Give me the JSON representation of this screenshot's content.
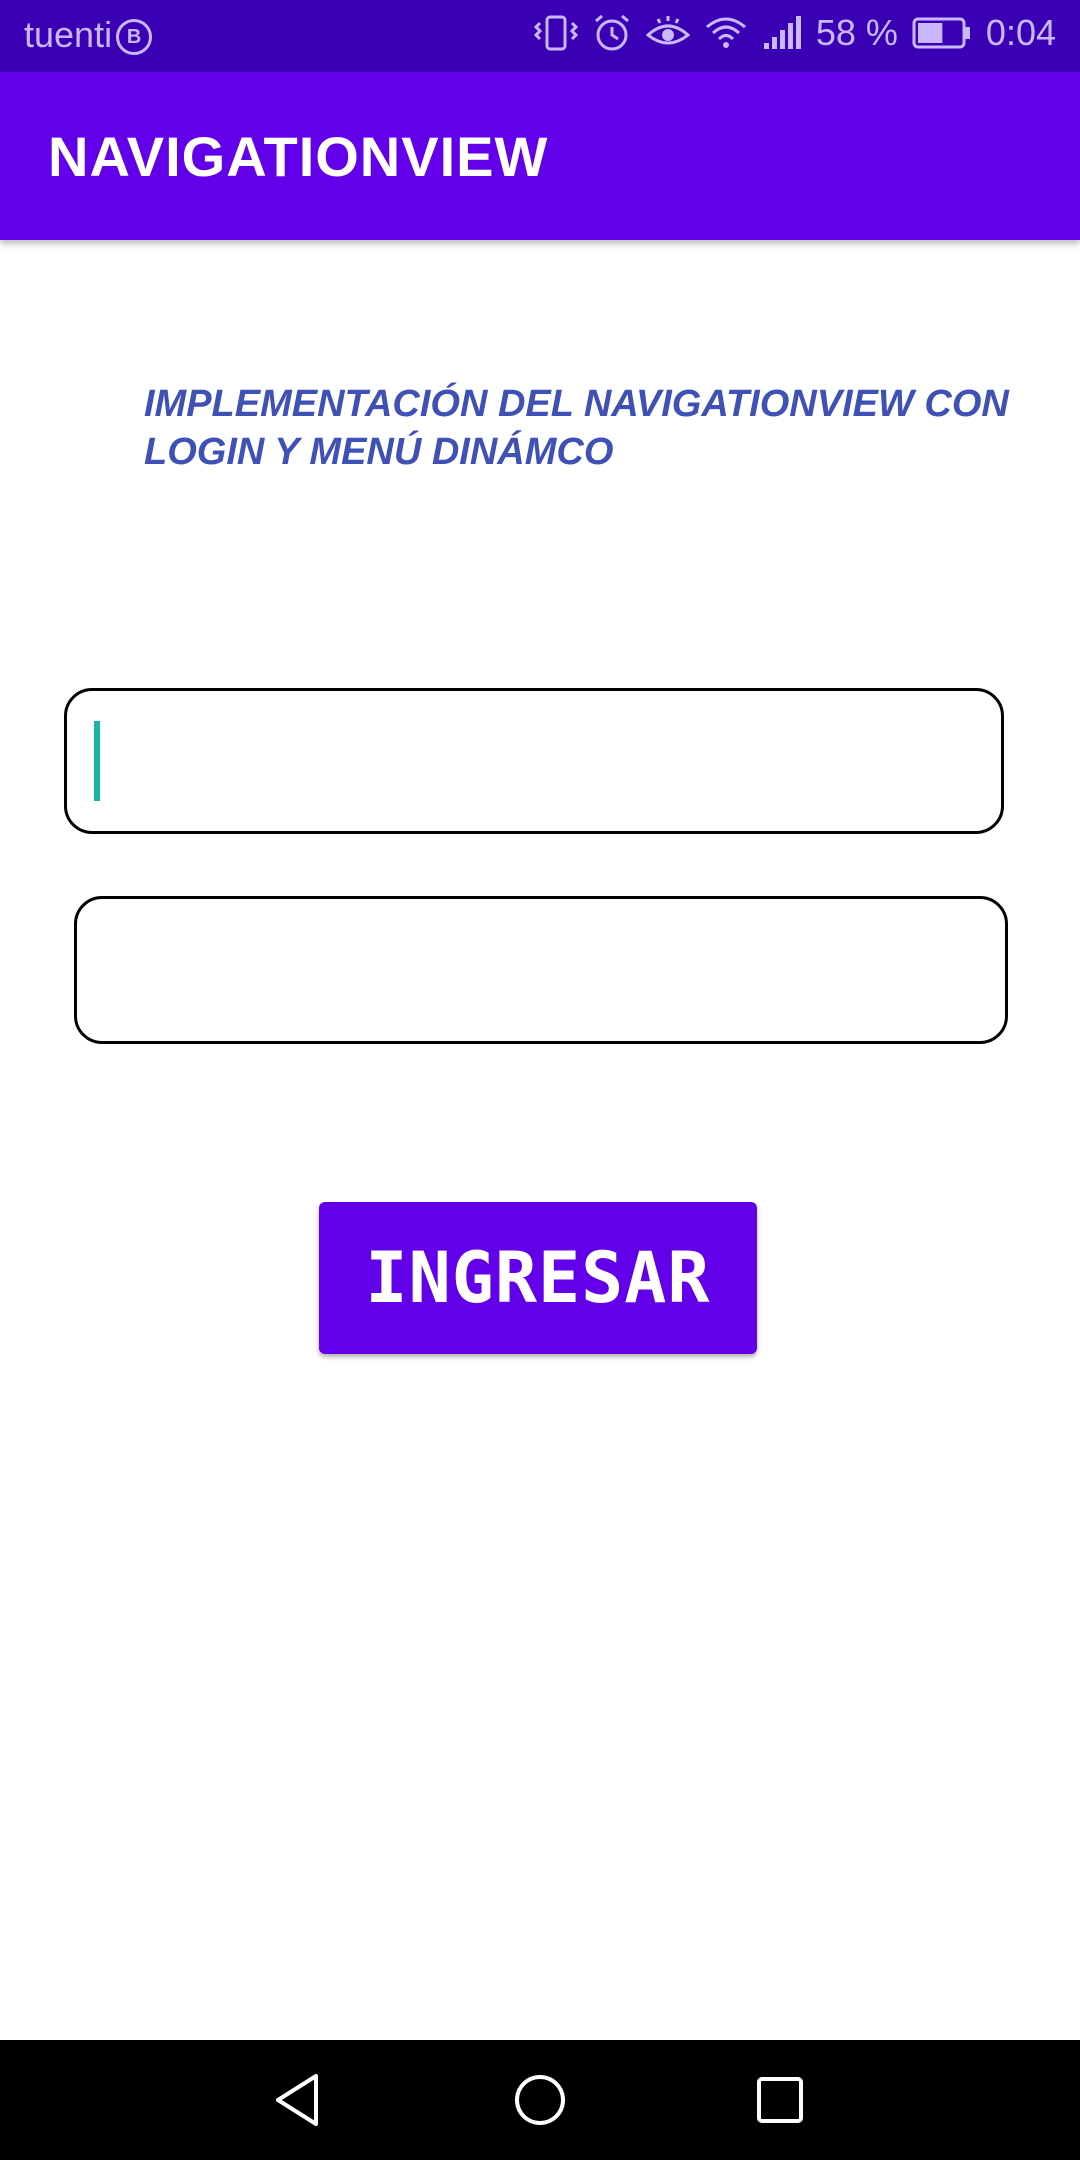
{
  "status_bar": {
    "carrier": "tuenti",
    "carrier_badge": "B",
    "battery_percent": "58 %",
    "battery_level": 0.58,
    "time": "0:04"
  },
  "app_bar": {
    "title": "NAVIGATIONVIEW"
  },
  "main": {
    "headline": "IMPLEMENTACIÓN DEL NAVIGATIONVIEW CON LOGIN Y MENÚ DINÁMCO",
    "username_value": "",
    "password_value": "",
    "login_button": "INGRESAR"
  },
  "colors": {
    "status_bar": "#3a00b4",
    "primary": "#6200ea",
    "headline_text": "#3f51b5",
    "cursor": "#16b6a7"
  },
  "icons": [
    "vibrate-icon",
    "alarm-icon",
    "eye-comfort-icon",
    "wifi-icon",
    "signal-icon",
    "battery-icon",
    "back-icon",
    "home-icon",
    "recents-icon"
  ]
}
